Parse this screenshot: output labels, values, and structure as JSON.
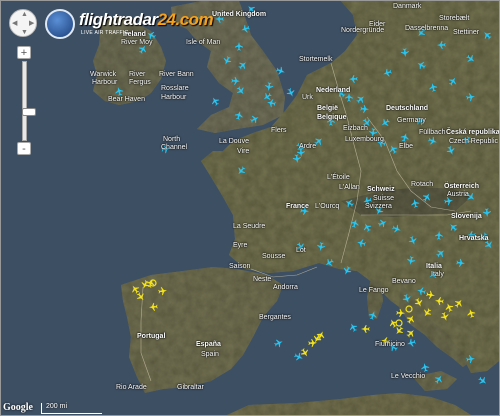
{
  "app": {
    "logo_text": "flightradar",
    "logo_domain": "24.com",
    "logo_tagline": "LIVE AIR TRAFFIC",
    "attribution": "Google",
    "scale_label": "200 mi"
  },
  "colors": {
    "sea": "#3d4f63",
    "land": "#71705a",
    "land_dark": "#5f6047",
    "aircraft_cyan": "#29c4f0",
    "aircraft_yellow": "#f4e21b",
    "labels": "#ffffff"
  },
  "controls": {
    "pan_icon": "pan-control-icon",
    "zoom_in_label": "+",
    "zoom_out_label": "-",
    "zoom_level_fraction": 0.35
  },
  "places": [
    {
      "id": "united-kingdom",
      "text": "United Kingdom",
      "kind": "country"
    },
    {
      "id": "ireland",
      "text": "Ireland",
      "kind": "country"
    },
    {
      "id": "isle-of-man",
      "text": "Isle of Man",
      "kind": "place"
    },
    {
      "id": "river-moy",
      "text": "River Moy",
      "kind": "place"
    },
    {
      "id": "warwick-harbour",
      "text": "Warwick",
      "kind": "place"
    },
    {
      "id": "harbour",
      "text": "Harbour",
      "kind": "place"
    },
    {
      "id": "river",
      "text": "River",
      "kind": "place"
    },
    {
      "id": "fergus",
      "text": "Fergus",
      "kind": "place"
    },
    {
      "id": "river-bann",
      "text": "River Bann",
      "kind": "place"
    },
    {
      "id": "bear-haven",
      "text": "Bear Haven",
      "kind": "place"
    },
    {
      "id": "rosslare-harbour",
      "text": "Rosslare",
      "kind": "place"
    },
    {
      "id": "harbour2",
      "text": "Harbour",
      "kind": "place"
    },
    {
      "id": "north-channel",
      "text": "North",
      "kind": "place"
    },
    {
      "id": "channel",
      "text": "Channel",
      "kind": "place"
    },
    {
      "id": "la-douve",
      "text": "La Douve",
      "kind": "place"
    },
    {
      "id": "vire",
      "text": "Vire",
      "kind": "place"
    },
    {
      "id": "flers",
      "text": "Flers",
      "kind": "place"
    },
    {
      "id": "ardre",
      "text": "Ardre",
      "kind": "place"
    },
    {
      "id": "france",
      "text": "France",
      "kind": "country"
    },
    {
      "id": "la-seudre",
      "text": "La Seudre",
      "kind": "place"
    },
    {
      "id": "eyre",
      "text": "Eyre",
      "kind": "place"
    },
    {
      "id": "saison",
      "text": "Saison",
      "kind": "place"
    },
    {
      "id": "neste",
      "text": "Neste",
      "kind": "place"
    },
    {
      "id": "andorra",
      "text": "Andorra",
      "kind": "place"
    },
    {
      "id": "sousse",
      "text": "Sousse",
      "kind": "place"
    },
    {
      "id": "lot",
      "text": "Lot",
      "kind": "place"
    },
    {
      "id": "lourcq",
      "text": "L'Ourcq",
      "kind": "place"
    },
    {
      "id": "lallan",
      "text": "L'Allan",
      "kind": "place"
    },
    {
      "id": "loire",
      "text": "L'Étoile",
      "kind": "place"
    },
    {
      "id": "nederland",
      "text": "Nederland",
      "kind": "country"
    },
    {
      "id": "belgie",
      "text": "België",
      "kind": "country"
    },
    {
      "id": "belgique",
      "text": "Belgique",
      "kind": "country"
    },
    {
      "id": "luxembourg",
      "text": "Luxembourg",
      "kind": "place"
    },
    {
      "id": "eizbach",
      "text": "Eizbach",
      "kind": "place"
    },
    {
      "id": "urk",
      "text": "Urk",
      "kind": "place"
    },
    {
      "id": "stortemelk",
      "text": "Stortemelk",
      "kind": "place"
    },
    {
      "id": "deutschland",
      "text": "Deutschland",
      "kind": "country"
    },
    {
      "id": "germany",
      "text": "Germany",
      "kind": "place"
    },
    {
      "id": "schweiz",
      "text": "Schweiz",
      "kind": "country"
    },
    {
      "id": "suisse",
      "text": "Suisse",
      "kind": "place"
    },
    {
      "id": "svizzera",
      "text": "Svizzera",
      "kind": "place"
    },
    {
      "id": "osterreich",
      "text": "Österreich",
      "kind": "country"
    },
    {
      "id": "austria",
      "text": "Austria",
      "kind": "place"
    },
    {
      "id": "rotach",
      "text": "Rotach",
      "kind": "place"
    },
    {
      "id": "elbe",
      "text": "Elbe",
      "kind": "place"
    },
    {
      "id": "fullbach",
      "text": "Füllbach",
      "kind": "place"
    },
    {
      "id": "ceska",
      "text": "Česká republika",
      "kind": "country"
    },
    {
      "id": "czech",
      "text": "Czech Republic",
      "kind": "place"
    },
    {
      "id": "slovenija",
      "text": "Slovenija",
      "kind": "country"
    },
    {
      "id": "hrvatska",
      "text": "Hrvatska",
      "kind": "country"
    },
    {
      "id": "italia",
      "text": "Italia",
      "kind": "country"
    },
    {
      "id": "italy",
      "text": "Italy",
      "kind": "place"
    },
    {
      "id": "le-fango",
      "text": "Le Fango",
      "kind": "place"
    },
    {
      "id": "bevano",
      "text": "Bevano",
      "kind": "place"
    },
    {
      "id": "fiumicino",
      "text": "Fiumicino",
      "kind": "place"
    },
    {
      "id": "espana",
      "text": "España",
      "kind": "country"
    },
    {
      "id": "spain",
      "text": "Spain",
      "kind": "place"
    },
    {
      "id": "portugal",
      "text": "Portugal",
      "kind": "country"
    },
    {
      "id": "bergantes",
      "text": "Bergantes",
      "kind": "place"
    },
    {
      "id": "gibraltar",
      "text": "Gibraltar",
      "kind": "place"
    },
    {
      "id": "rio-arade",
      "text": "Rio Arade",
      "kind": "place"
    },
    {
      "id": "le-vecchio",
      "text": "Le Vecchio",
      "kind": "place"
    },
    {
      "id": "denmark",
      "text": "Danmark",
      "kind": "place"
    },
    {
      "id": "storebaelt",
      "text": "Storebælt",
      "kind": "place"
    },
    {
      "id": "eider",
      "text": "Eider",
      "kind": "place"
    },
    {
      "id": "nordergrunde",
      "text": "Nordergründe",
      "kind": "place"
    },
    {
      "id": "dasselbrenna",
      "text": "Dasselbrenna",
      "kind": "place"
    },
    {
      "id": "stettiner",
      "text": "Stettiner",
      "kind": "place"
    }
  ],
  "aircraft": [
    {
      "color": "cyan",
      "count": 1
    }
  ]
}
